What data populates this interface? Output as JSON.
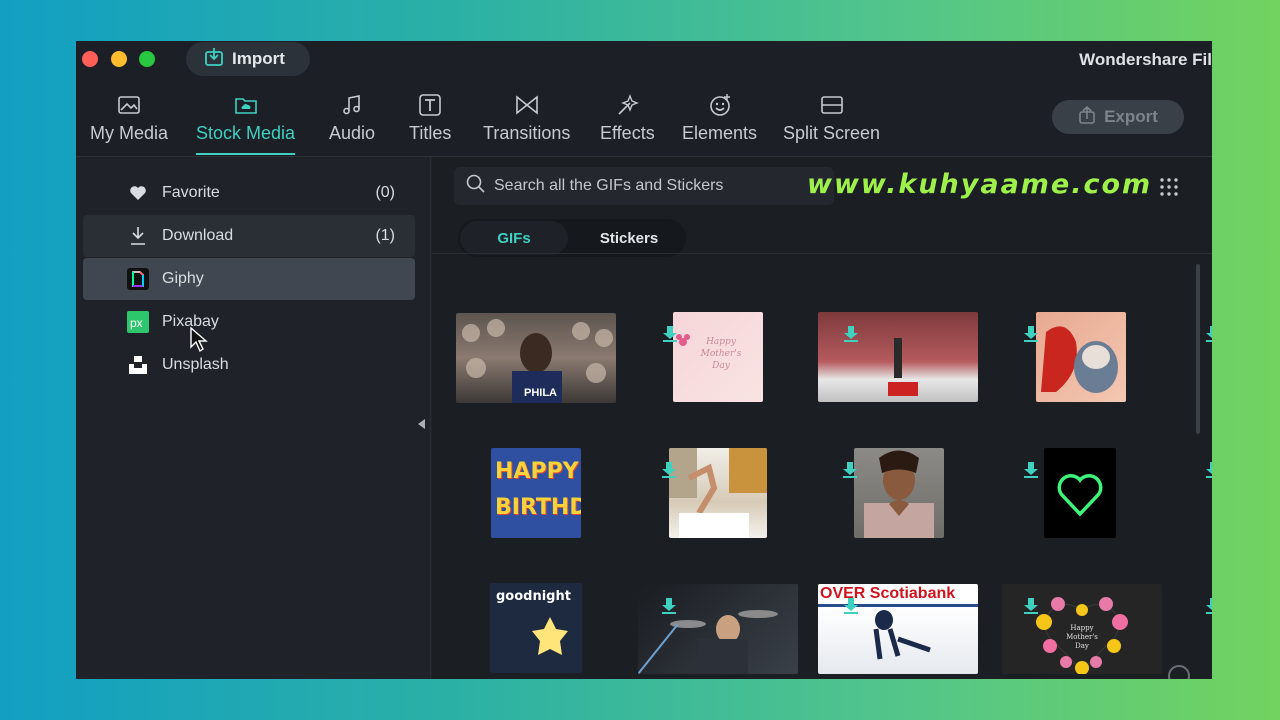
{
  "window": {
    "app_title": "Wondershare Fil",
    "import_label": "Import",
    "export_label": "Export"
  },
  "tabs": [
    {
      "label": "My Media",
      "icon": "image-icon"
    },
    {
      "label": "Stock Media",
      "icon": "cloud-folder-icon",
      "active": true
    },
    {
      "label": "Audio",
      "icon": "music-note-icon"
    },
    {
      "label": "Titles",
      "icon": "text-icon"
    },
    {
      "label": "Transitions",
      "icon": "transition-icon"
    },
    {
      "label": "Effects",
      "icon": "effects-sparkle-icon"
    },
    {
      "label": "Elements",
      "icon": "smiley-icon"
    },
    {
      "label": "Split Screen",
      "icon": "split-screen-icon"
    }
  ],
  "sidebar": {
    "items": [
      {
        "label": "Favorite",
        "count": "(0)",
        "icon": "heart-icon"
      },
      {
        "label": "Download",
        "count": "(1)",
        "icon": "download-icon"
      },
      {
        "label": "Giphy",
        "count": "",
        "icon": "giphy-icon"
      },
      {
        "label": "Pixabay",
        "count": "",
        "icon": "pixabay-icon"
      },
      {
        "label": "Unsplash",
        "count": "",
        "icon": "unsplash-icon"
      }
    ]
  },
  "search": {
    "placeholder": "Search all the GIFs and Stickers"
  },
  "watermark": "www.kuhyaame.com",
  "segments": {
    "gifs": "GIFs",
    "stickers": "Stickers"
  },
  "gifs": [
    {
      "name": "basketball-fans",
      "caption": "PHILA"
    },
    {
      "name": "happy-mothers-day-card",
      "caption": "Happy Mother's Day"
    },
    {
      "name": "crowd-arena"
    },
    {
      "name": "cartoon-cat"
    },
    {
      "name": "happy-birthday",
      "caption": "HAPPY BIRTHDAY"
    },
    {
      "name": "bedroom-dance"
    },
    {
      "name": "man-heart-hands"
    },
    {
      "name": "neon-heart"
    },
    {
      "name": "goodnight",
      "caption": "goodnight"
    },
    {
      "name": "drummer"
    },
    {
      "name": "hockey",
      "caption": "OVER Scotiabank"
    },
    {
      "name": "flower-wreath",
      "caption": "Happy Mother's Day"
    }
  ],
  "colors": {
    "accent": "#3fd0c0",
    "window_bg": "#1f2329",
    "watermark": "#9ef04a"
  }
}
